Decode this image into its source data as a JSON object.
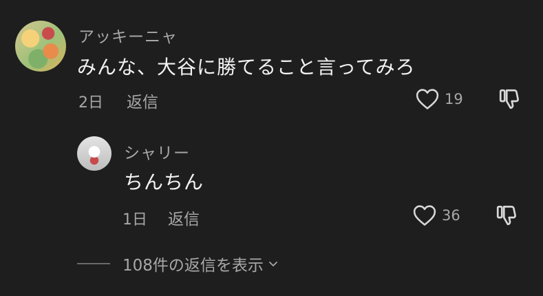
{
  "comment": {
    "username": "アッキーニャ",
    "text": "みんな、大谷に勝てること言ってみろ",
    "time": "2日",
    "reply_label": "返信",
    "likes": "19"
  },
  "reply": {
    "username": "シャリー",
    "text": "ちんちん",
    "time": "1日",
    "reply_label": "返信",
    "likes": "36"
  },
  "view_replies": {
    "label": "108件の返信を表示"
  },
  "icons": {
    "like": "heart-icon",
    "dislike": "thumbs-down-icon",
    "expand": "chevron-down-icon"
  },
  "colors": {
    "background": "#1e1e1e",
    "primary_text": "#f2f2f2",
    "secondary_text": "#a8a8a8"
  }
}
